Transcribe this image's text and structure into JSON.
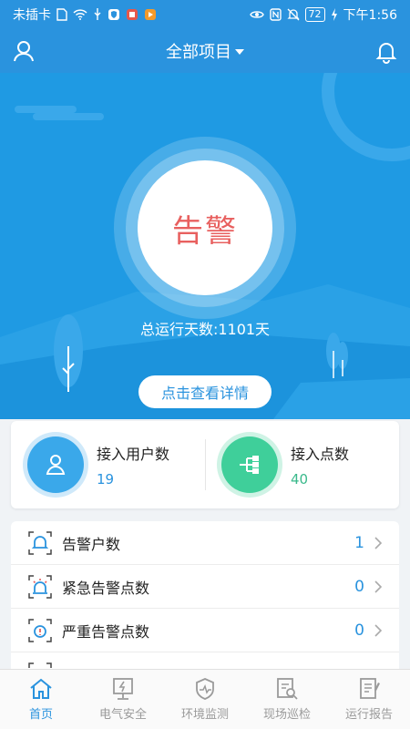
{
  "status_bar": {
    "carrier": "未插卡",
    "battery": "72",
    "time": "下午1:56"
  },
  "header": {
    "title": "全部项目"
  },
  "hero": {
    "status": "告警",
    "run_days": "总运行天数:1101天",
    "detail_button": "点击查看详情"
  },
  "stats": [
    {
      "label": "接入用户数",
      "value": "19"
    },
    {
      "label": "接入点数",
      "value": "40"
    }
  ],
  "list": [
    {
      "label": "告警户数",
      "count": "1"
    },
    {
      "label": "紧急告警点数",
      "count": "0"
    },
    {
      "label": "严重告警点数",
      "count": "0"
    }
  ],
  "nav": [
    {
      "label": "首页",
      "icon": "home-icon",
      "active": true
    },
    {
      "label": "电气安全",
      "icon": "electrical-icon"
    },
    {
      "label": "环境监测",
      "icon": "environment-icon"
    },
    {
      "label": "现场巡检",
      "icon": "inspection-icon"
    },
    {
      "label": "运行报告",
      "icon": "report-icon"
    }
  ],
  "colors": {
    "primary": "#2a93de",
    "alarm": "#e8605f",
    "green": "#3ab98b"
  }
}
